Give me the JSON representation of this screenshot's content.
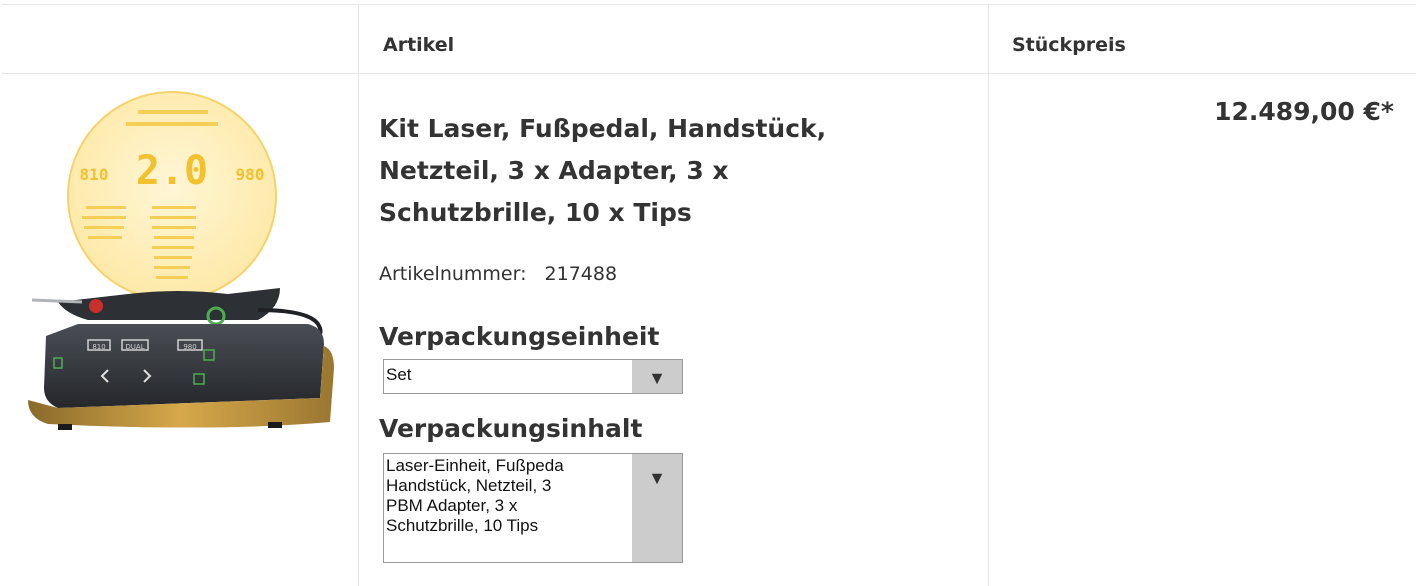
{
  "table": {
    "headers": {
      "image": "",
      "article": "Artikel",
      "unit_price": "Stückpreis"
    }
  },
  "product": {
    "image_alt": "Dental laser unit with foot pedal and handpiece",
    "title_lines": [
      "Kit Laser, Fußpedal, Handstück,",
      "Netzteil, 3 x Adapter, 3 x",
      "Schutzbrille, 10 x Tips"
    ],
    "sku_label": "Artikelnummer:",
    "sku_value": "217488",
    "packaging_unit": {
      "label": "Verpackungseinheit",
      "selected": "Set",
      "arrow": "▼"
    },
    "packaging_content": {
      "label": "Verpackungsinhalt",
      "lines": [
        "Laser-Einheit, Fußpeda",
        "Handstück, Netzteil, 3",
        "PBM Adapter, 3 x",
        "Schutzbrille, 10 Tips"
      ],
      "arrow": "▼"
    },
    "price": "12.489,00 €*"
  },
  "colors": {
    "border": "#e6e6e6",
    "text": "#333333",
    "select_arrow_bg": "#cccccc",
    "laser_display": "#f5c93c",
    "device_body": "#3a3d42",
    "device_base": "#b8892f"
  }
}
